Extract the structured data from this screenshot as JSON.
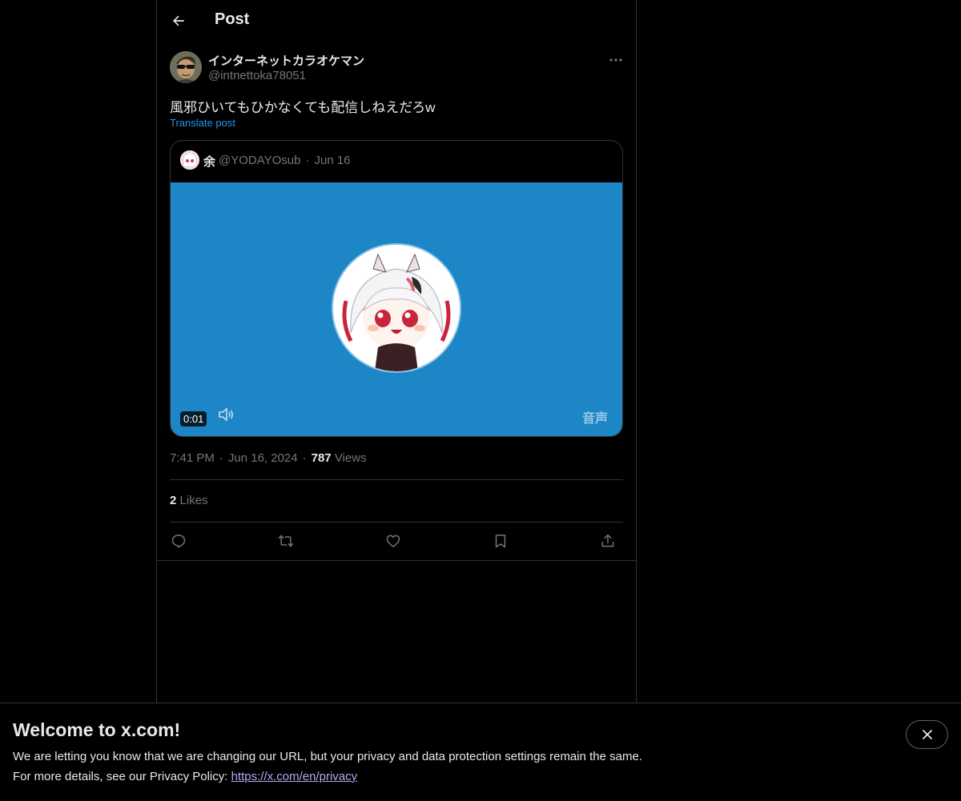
{
  "header": {
    "title": "Post"
  },
  "post": {
    "author_name": "インターネットカラオケマン",
    "author_handle": "@intnettoka78051",
    "text": "風邪ひいてもひかなくても配信しねえだろw",
    "translate_label": "Translate post",
    "quote": {
      "name": "余",
      "handle": "@YODAYOsub",
      "date": "Jun 16",
      "video": {
        "duration": "0:01",
        "audio_label": "音声",
        "bg_color": "#1d86c7"
      }
    },
    "time": "7:41 PM",
    "date": "Jun 16, 2024",
    "views_count": "787",
    "views_label": "Views",
    "likes_count": "2",
    "likes_label": "Likes"
  },
  "actions": [
    "reply-icon",
    "repost-icon",
    "like-icon",
    "bookmark-icon",
    "share-icon"
  ],
  "banner": {
    "title": "Welcome to x.com!",
    "line1": "We are letting you know that we are changing our URL, but your privacy and data protection settings remain the same.",
    "line2_prefix": "For more details, see our Privacy Policy: ",
    "link": "https://x.com/en/privacy"
  },
  "colors": {
    "accent": "#1d9bf0",
    "border": "#2f3336",
    "muted": "#71767b",
    "text": "#e7e9ea"
  }
}
